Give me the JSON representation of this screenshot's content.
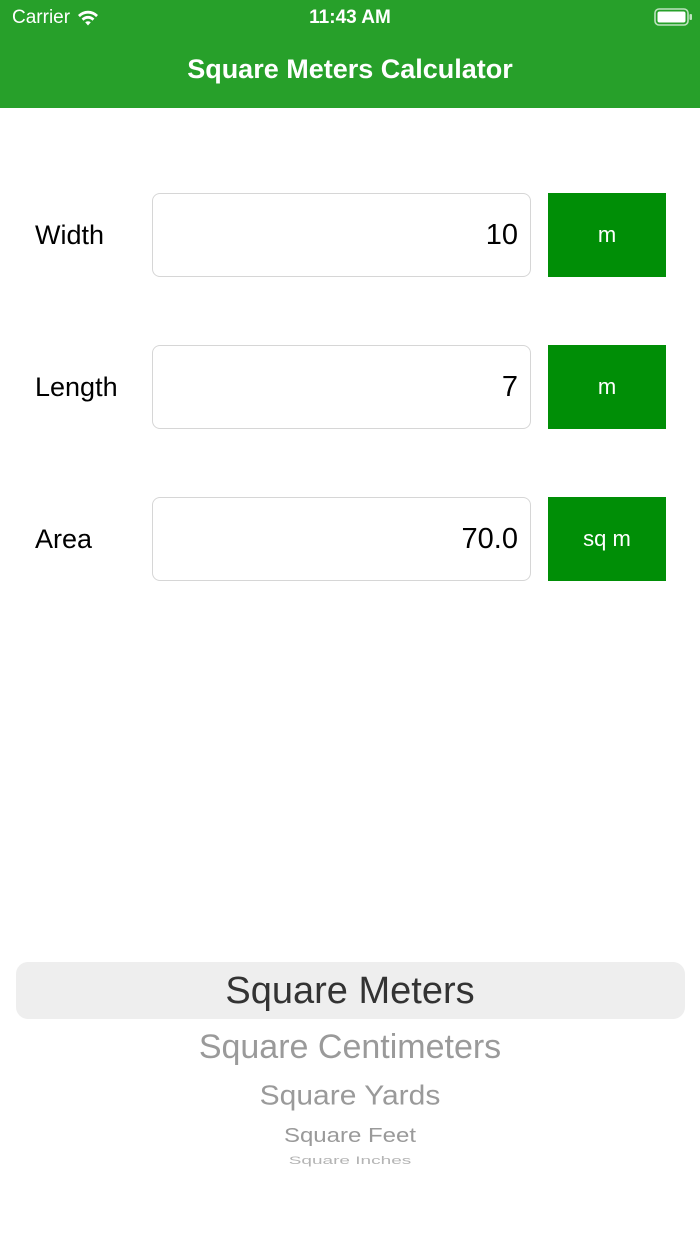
{
  "status_bar": {
    "carrier": "Carrier",
    "time": "11:43 AM",
    "icons": [
      "wifi-icon",
      "battery-icon"
    ]
  },
  "nav": {
    "title": "Square Meters Calculator",
    "background": "#27a02a"
  },
  "rows": [
    {
      "label": "Width",
      "value": "10",
      "unit": "m"
    },
    {
      "label": "Length",
      "value": "7",
      "unit": "m"
    },
    {
      "label": "Area",
      "value": "70.0",
      "unit": "sq m"
    }
  ],
  "unit_button_color": "#008e06",
  "picker": {
    "selected": "Square Meters",
    "options": [
      "Square Meters",
      "Square Centimeters",
      "Square Yards",
      "Square Feet",
      "Square Inches"
    ]
  }
}
